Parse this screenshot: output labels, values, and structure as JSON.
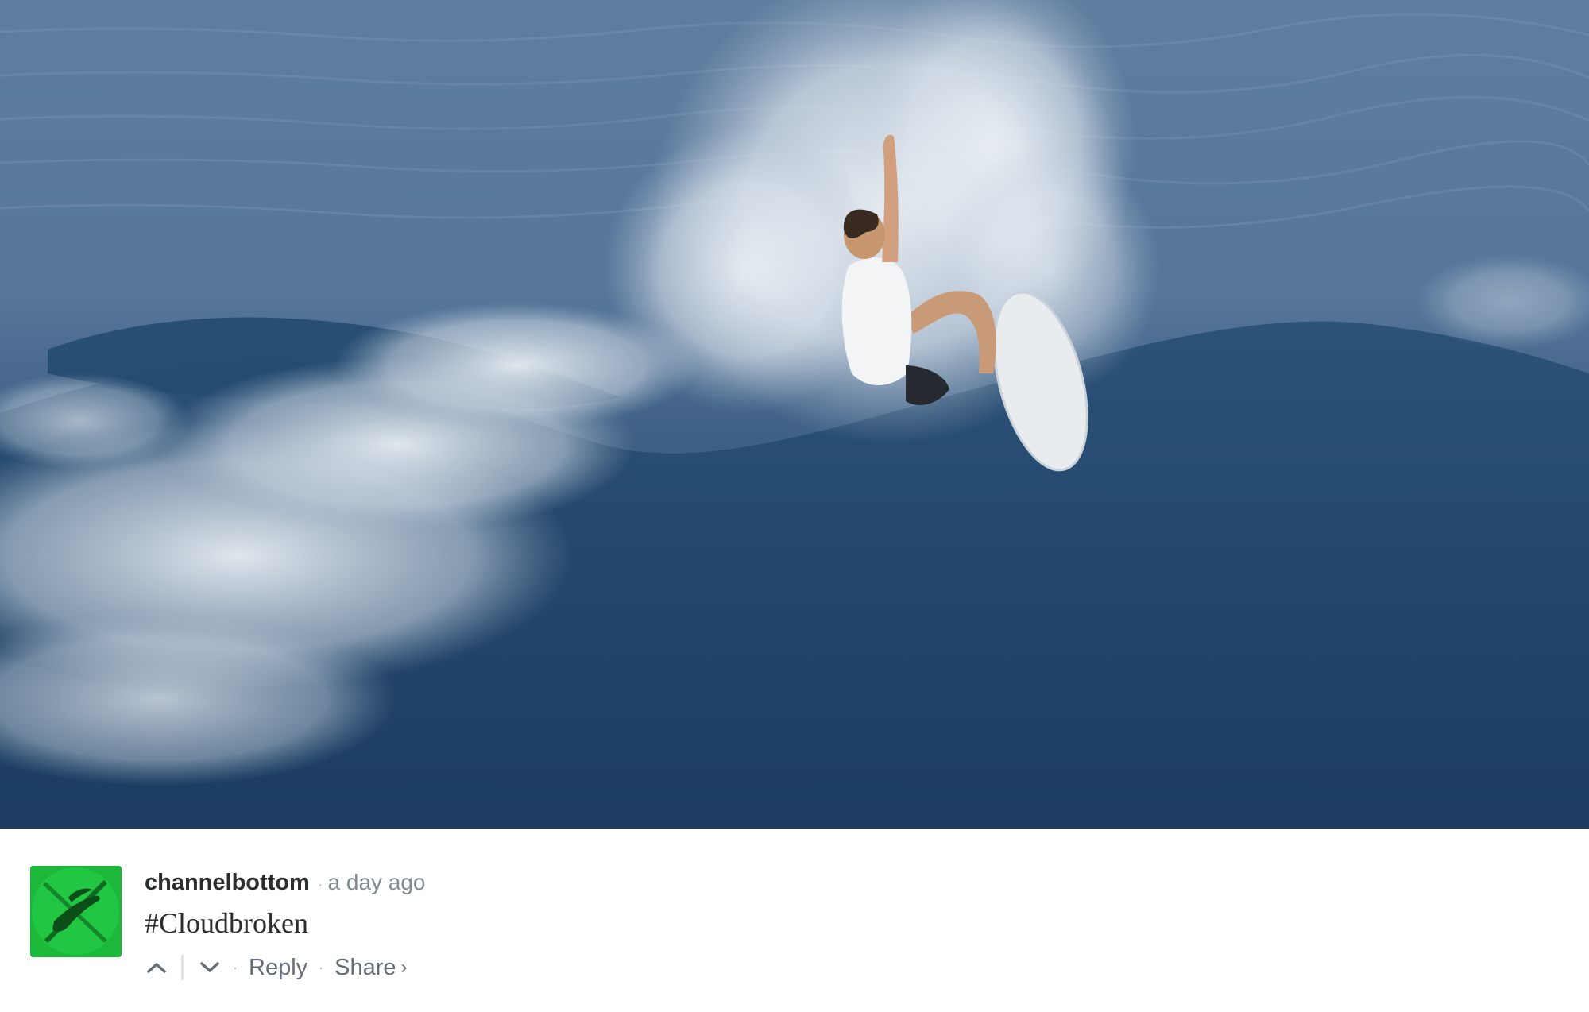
{
  "media": {
    "icon": "surf-photo"
  },
  "comment": {
    "username": "channelbottom",
    "separator": "·",
    "timestamp": "a day ago",
    "message": "#Cloudbroken",
    "actions": {
      "reply_label": "Reply",
      "share_label": "Share",
      "share_chevron": "›",
      "action_separator": "·"
    }
  },
  "colors": {
    "username": "#2a2e2e",
    "meta_text": "#7f8b93",
    "action_text": "#656c7a",
    "avatar_green": "#1cb83a",
    "ocean_deep": "#284c70",
    "ocean_light": "#6a87a8"
  }
}
